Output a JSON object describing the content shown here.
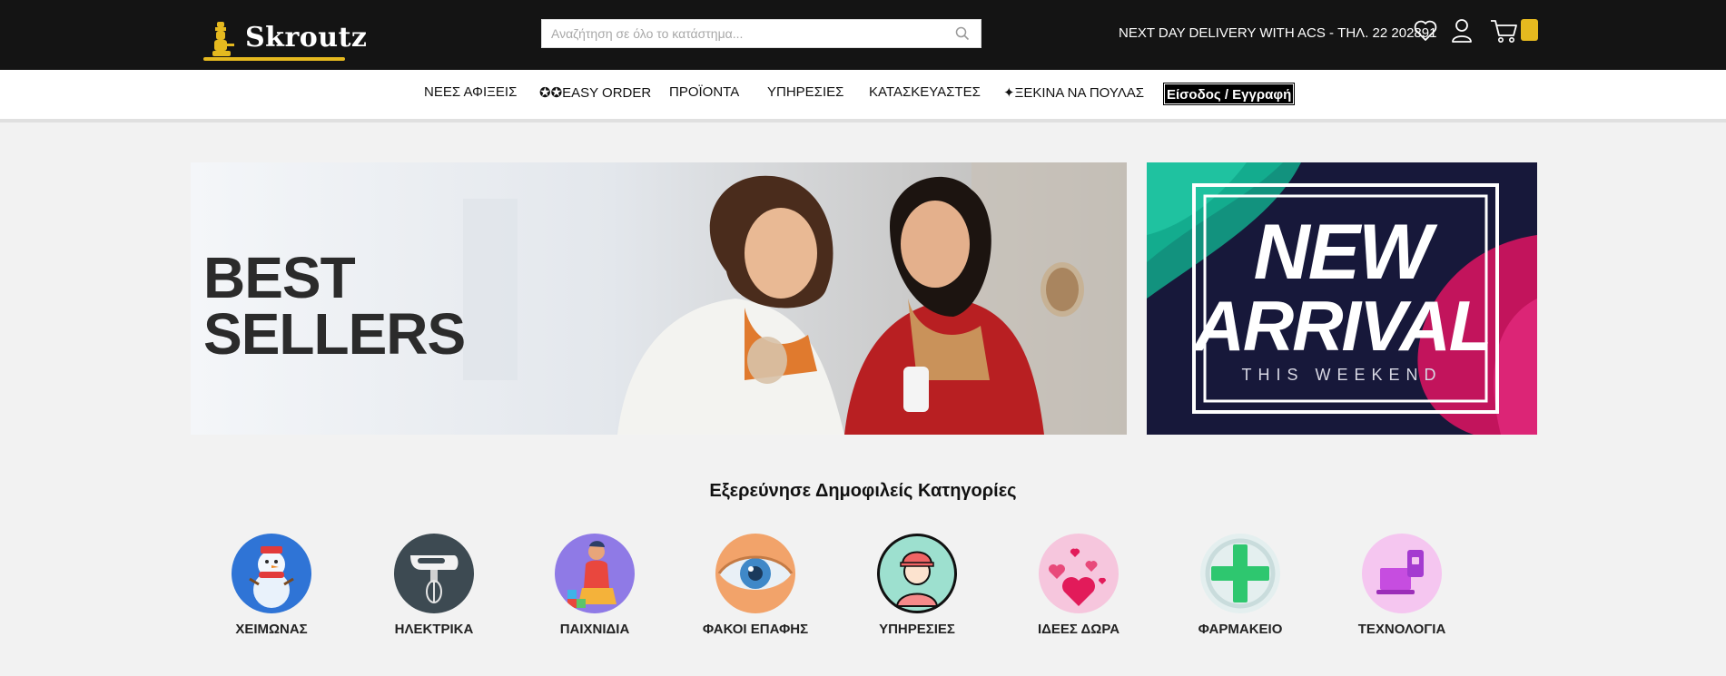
{
  "header": {
    "brand": "Skroutz",
    "search_placeholder": "Αναζήτηση σε όλο το κατάστημα...",
    "delivery_text": "NEXT DAY DELIVERY WITH ACS - ΤΗΛ. 22 202891",
    "icons": [
      "search-icon",
      "heart-icon",
      "user-icon",
      "cart-icon"
    ],
    "accent_color": "#e5b91f"
  },
  "nav": {
    "items": [
      {
        "label": "ΝΕΕΣ ΑΦΙΞΕΙΣ"
      },
      {
        "label": "✪✪EASY ORDER"
      },
      {
        "label": "ΠΡΟΪΟΝΤΑ"
      },
      {
        "label": "ΥΠΗΡΕΣΙΕΣ"
      },
      {
        "label": "ΚΑΤΑΣΚΕΥΑΣΤΕΣ"
      },
      {
        "label": "✦ΞΕΚΙΝΑ ΝΑ ΠΟΥΛΑΣ"
      }
    ],
    "login_label": "Είσοδος / Εγγραφή"
  },
  "banners": {
    "left_line1": "BEST",
    "left_line2": "SELLERS",
    "right_line1": "NEW",
    "right_line2": "ARRIVAL",
    "right_sub": "THIS WEEKEND"
  },
  "categories": {
    "title": "Εξερεύνησε Δημοφιλείς Κατηγορίες",
    "items": [
      {
        "label": "ΧΕΙΜΩΝΑΣ",
        "icon": "snowman-icon"
      },
      {
        "label": "ΗΛΕΚΤΡΙΚΑ",
        "icon": "hand-mixer-icon"
      },
      {
        "label": "ΠΑΙΧΝΙΔΙΑ",
        "icon": "child-playing-icon"
      },
      {
        "label": "ΦΑΚΟΙ ΕΠΑΦΗΣ",
        "icon": "eye-icon"
      },
      {
        "label": "ΥΠΗΡΕΣΙΕΣ",
        "icon": "worker-icon"
      },
      {
        "label": "ΙΔΕΕΣ ΔΩΡΑ",
        "icon": "hearts-icon"
      },
      {
        "label": "ΦΑΡΜΑΚΕΙΟ",
        "icon": "pharmacy-cross-icon"
      },
      {
        "label": "ΤΕΧΝΟΛΟΓΙΑ",
        "icon": "devices-icon"
      }
    ]
  }
}
